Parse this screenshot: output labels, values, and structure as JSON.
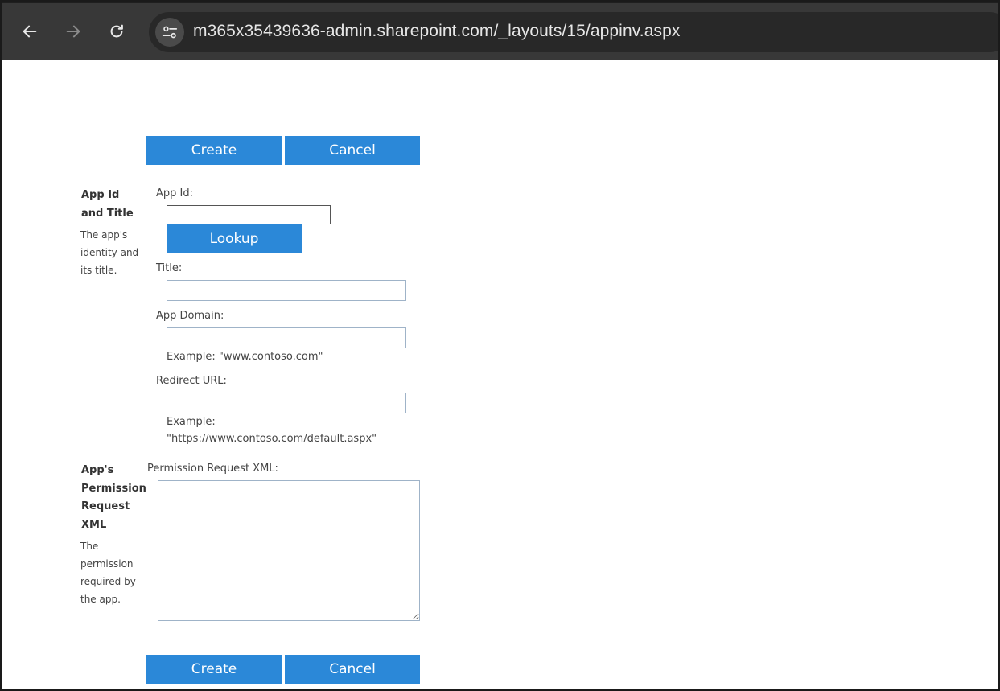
{
  "browser": {
    "url": "m365x35439636-admin.sharepoint.com/_layouts/15/appinv.aspx",
    "icons": {
      "back": "back-arrow-icon",
      "forward": "forward-arrow-icon",
      "reload": "reload-icon",
      "site_info": "tune-icon"
    }
  },
  "form": {
    "top_buttons": {
      "create": "Create",
      "cancel": "Cancel"
    },
    "bottom_buttons": {
      "create": "Create",
      "cancel": "Cancel"
    },
    "section1": {
      "title": "App Id and Title",
      "description": "The app's identity and its title.",
      "app_id_label": "App Id:",
      "app_id_value": "",
      "lookup_button": "Lookup",
      "title_label": "Title:",
      "title_value": "",
      "app_domain_label": "App Domain:",
      "app_domain_value": "",
      "app_domain_example": "Example: \"www.contoso.com\"",
      "redirect_label": "Redirect URL:",
      "redirect_value": "",
      "redirect_example": "Example: \"https://www.contoso.com/default.aspx\""
    },
    "section2": {
      "title": "App's Permission Request XML",
      "description": "The permission required by the app.",
      "xml_label": "Permission Request XML:",
      "xml_value": ""
    }
  },
  "colors": {
    "button_blue": "#2b88d8",
    "toolbar": "#383838",
    "omnibox": "#282828"
  }
}
